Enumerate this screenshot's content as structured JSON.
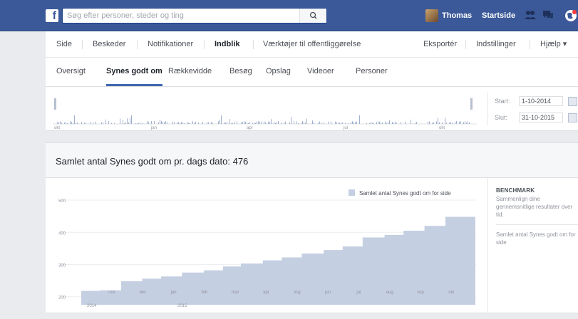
{
  "topbar": {
    "logo": "f",
    "search_placeholder": "Søg efter personer, steder og ting",
    "user_name": "Thomas",
    "home_label": "Startside",
    "icons": [
      "friends-icon",
      "messages-icon",
      "globe-icon"
    ]
  },
  "page_tabs": [
    {
      "label": "Side",
      "active": false
    },
    {
      "label": "Beskeder",
      "active": false
    },
    {
      "label": "Notifikationer",
      "active": false
    },
    {
      "label": "Indblik",
      "active": true
    },
    {
      "label": "Værktøjer til offentliggørelse",
      "active": false
    }
  ],
  "page_actions": {
    "export": "Eksportér",
    "settings": "Indstillinger",
    "help": "Hjælp ▾"
  },
  "insights_tabs": [
    {
      "label": "Oversigt",
      "active": false
    },
    {
      "label": "Synes godt om",
      "active": true
    },
    {
      "label": "Rækkevidde",
      "active": false
    },
    {
      "label": "Besøg",
      "active": false
    },
    {
      "label": "Opslag",
      "active": false
    },
    {
      "label": "Videoer",
      "active": false
    },
    {
      "label": "Personer",
      "active": false
    }
  ],
  "timeline": {
    "month_labels": [
      "okt",
      "jan",
      "apr",
      "jul",
      "okt"
    ],
    "start_label": "Start:",
    "start_value": "1-10-2014",
    "end_label": "Slut:",
    "end_value": "31-10-2015"
  },
  "total": {
    "text": "Samlet antal Synes godt om pr. dags dato: 476"
  },
  "chart_data": {
    "type": "area",
    "legend": [
      "Samlet antal Synes godt om for side"
    ],
    "ylim": [
      175,
      520
    ],
    "yticks": [
      "200",
      "300",
      "400",
      "500"
    ],
    "xticks": [
      "nov",
      "dec",
      "jan",
      "feb",
      "mar",
      "apr",
      "maj",
      "jun",
      "jul",
      "aug",
      "sep",
      "okt"
    ],
    "year_labels": [
      "2014",
      "2015"
    ],
    "grid": true,
    "legend_position": "top-right",
    "color": "#c5cfe2",
    "series": [
      {
        "name": "Samlet antal Synes godt om for side",
        "x": [
          "2014-10-01",
          "2014-10-20",
          "2014-11-10",
          "2014-12-01",
          "2014-12-20",
          "2015-01-10",
          "2015-02-01",
          "2015-02-20",
          "2015-03-10",
          "2015-04-01",
          "2015-04-20",
          "2015-05-10",
          "2015-06-01",
          "2015-06-20",
          "2015-07-10",
          "2015-08-01",
          "2015-08-20",
          "2015-09-10",
          "2015-10-01",
          "2015-10-31"
        ],
        "values": [
          218,
          220,
          248,
          256,
          263,
          275,
          282,
          294,
          303,
          313,
          322,
          334,
          345,
          356,
          384,
          392,
          405,
          420,
          448,
          476
        ]
      }
    ]
  },
  "benchmark": {
    "title": "BENCHMARK",
    "description": "Sammenlign dine gennemsnitlige resultater over tid.",
    "metric": "Samlet antal Synes godt om for side"
  }
}
